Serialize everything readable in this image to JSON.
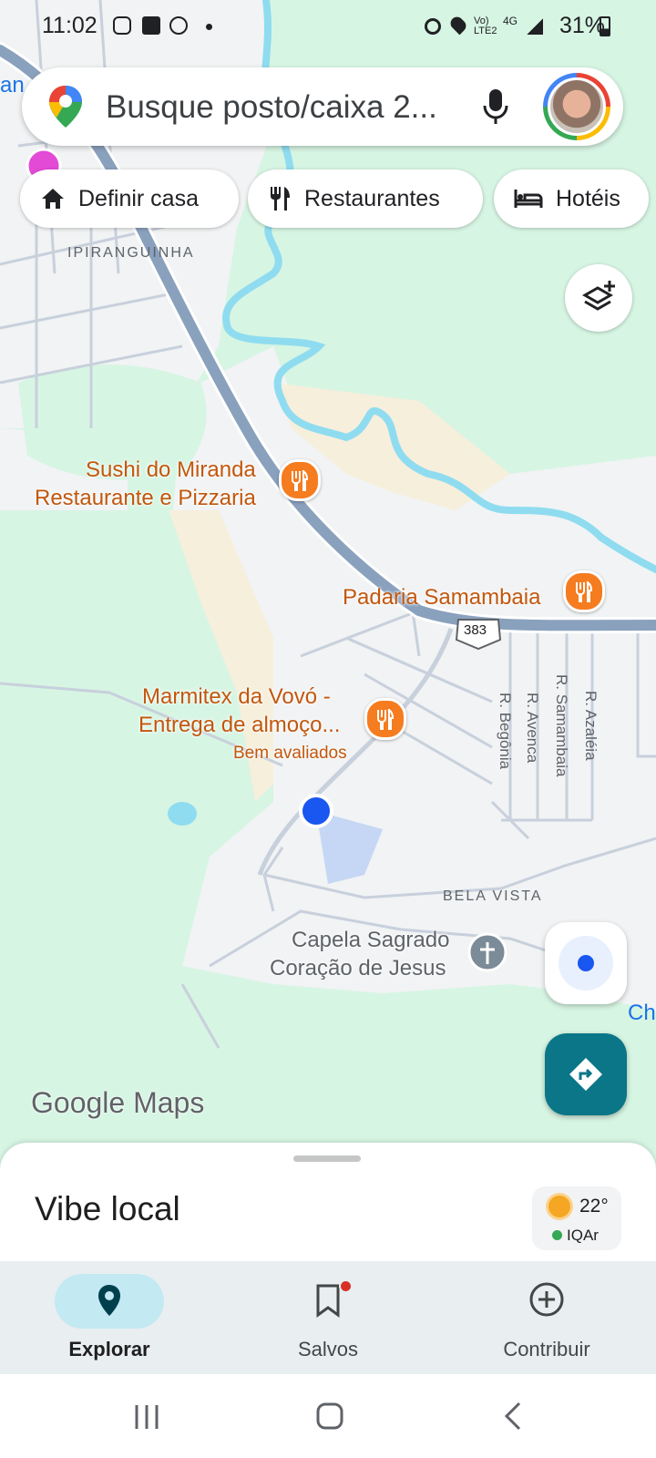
{
  "status_bar": {
    "time": "11:02",
    "battery": "31%"
  },
  "search": {
    "placeholder": "Busque posto/caixa 2..."
  },
  "chips": [
    {
      "label": "Definir casa",
      "icon": "home-icon"
    },
    {
      "label": "Restaurantes",
      "icon": "fork-knife-icon"
    },
    {
      "label": "Hotéis",
      "icon": "bed-icon"
    }
  ],
  "map_labels": {
    "edge_left": "an",
    "neighborhood_1": "IPIRANGUINHA",
    "sushi_line1": "Sushi do Miranda",
    "sushi_line2": "Restaurante e Pizzaria",
    "padaria": "Padaria Samambaia",
    "marmitex_line1": "Marmitex da Vovó -",
    "marmitex_line2": "Entrega de almoço...",
    "marmitex_tag": "Bem avaliados",
    "route_shield": "383",
    "street_1": "R. Begônia",
    "street_2": "R. Avenca",
    "street_3": "R. Samambaia",
    "street_4": "R. Azaléia",
    "neighborhood_2": "BELA VISTA",
    "chapel_line1": "Capela Sagrado",
    "chapel_line2": "Coração de Jesus",
    "edge_right": "Ch",
    "watermark": "Google Maps"
  },
  "sheet": {
    "title": "Vibe local",
    "temperature": "22°",
    "air_quality": "IQAr"
  },
  "nav": {
    "explore": "Explorar",
    "saved": "Salvos",
    "contribute": "Contribuir",
    "active": "Explorar"
  },
  "colors": {
    "park_green": "#d7f5e3",
    "land": "#f2f3f4",
    "highway": "#8aa1bd",
    "water": "#8fdcf0",
    "poi_orange": "#f57c1f",
    "accent_teal": "#0a7688",
    "location_blue": "#1a56f0"
  }
}
